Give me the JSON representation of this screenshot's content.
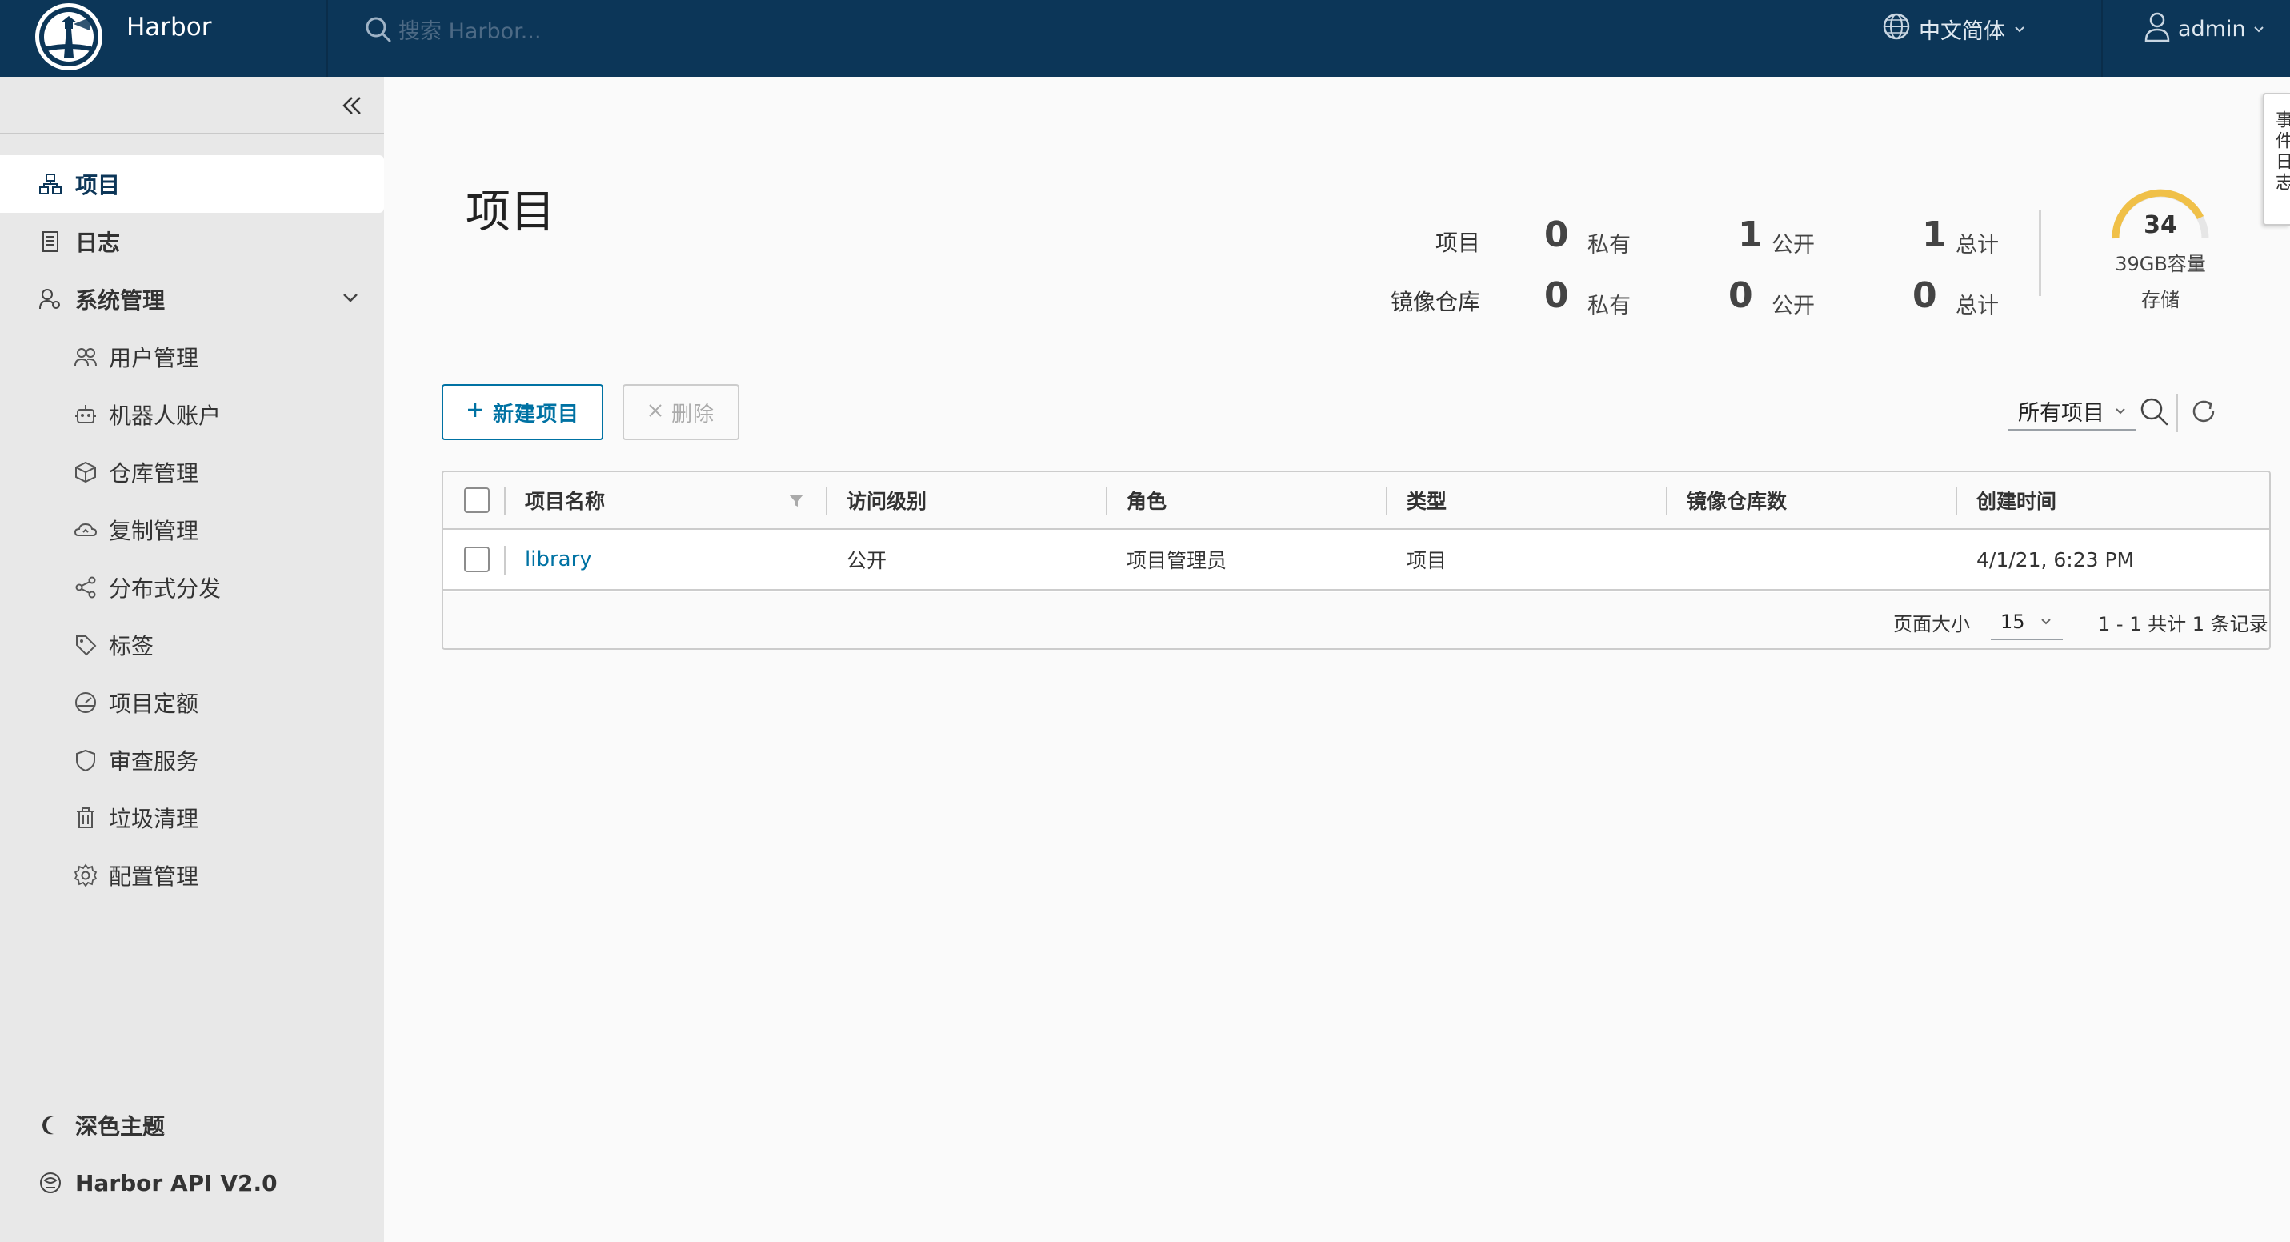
{
  "header": {
    "brand": "Harbor",
    "search_placeholder": "搜索 Harbor...",
    "language": "中文简体",
    "user": "admin"
  },
  "sidebar": {
    "items": [
      {
        "label": "项目",
        "icon": "projects-icon",
        "active": true
      },
      {
        "label": "日志",
        "icon": "logs-icon"
      },
      {
        "label": "系统管理",
        "icon": "admin-icon",
        "expanded": true
      }
    ],
    "sub_items": [
      {
        "label": "用户管理",
        "icon": "users-icon"
      },
      {
        "label": "机器人账户",
        "icon": "robot-icon"
      },
      {
        "label": "仓库管理",
        "icon": "registry-icon"
      },
      {
        "label": "复制管理",
        "icon": "replication-icon"
      },
      {
        "label": "分布式分发",
        "icon": "share-icon"
      },
      {
        "label": "标签",
        "icon": "tag-icon"
      },
      {
        "label": "项目定额",
        "icon": "quota-icon"
      },
      {
        "label": "审查服务",
        "icon": "shield-icon"
      },
      {
        "label": "垃圾清理",
        "icon": "trash-icon"
      },
      {
        "label": "配置管理",
        "icon": "gear-icon"
      }
    ],
    "footer": [
      {
        "label": "深色主题",
        "icon": "moon-icon"
      },
      {
        "label": "Harbor API V2.0",
        "icon": "api-icon"
      }
    ]
  },
  "main": {
    "title": "项目",
    "stats": {
      "projects_label": "项目",
      "repos_label": "镜像仓库",
      "projects": {
        "private": "0",
        "public": "1",
        "total": "1"
      },
      "repos": {
        "private": "0",
        "public": "0",
        "total": "0"
      },
      "private_label": "私有",
      "public_label": "公开",
      "total_label": "总计"
    },
    "storage": {
      "value": "34",
      "capacity": "39GB容量",
      "label": "存储"
    },
    "toolbar": {
      "new_label": "新建项目",
      "delete_label": "删除",
      "filter_value": "所有项目"
    },
    "table": {
      "columns": [
        "项目名称",
        "访问级别",
        "角色",
        "类型",
        "镜像仓库数",
        "创建时间"
      ],
      "rows": [
        {
          "name": "library",
          "access": "公开",
          "role": "项目管理员",
          "type": "项目",
          "repo_count": "",
          "created": "4/1/21, 6:23 PM"
        }
      ],
      "page_size_label": "页面大小",
      "page_size": "15",
      "summary": "1 - 1 共计 1 条记录"
    },
    "side_tab": "事件日志"
  },
  "colors": {
    "header_bg": "#0c3658",
    "accent": "#0072a3",
    "gauge": "#f0c048"
  }
}
